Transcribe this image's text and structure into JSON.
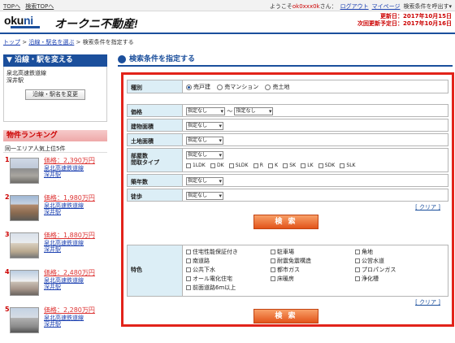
{
  "top_links": [
    "TOPへ",
    "検索TOPへ"
  ],
  "user_bar": {
    "prefix": "ようこそ",
    "user_id": "ok0xxx0k",
    "suffix": "さん：",
    "logout": "ログアウト",
    "mypage": "マイページ",
    "recall": "検索条件を呼出す▾"
  },
  "logo": {
    "okuni_a": "oku",
    "okuni_b": "ni",
    "brand": "オークニ不動産!"
  },
  "updates": {
    "line1": "更新日：2017年10月15日",
    "line2": "次回更新予定日：2017年10月16日"
  },
  "breadcrumb": {
    "top": "トップ",
    "sep1": " > ",
    "choose": "沿線・駅名を選ぶ",
    "sep2": " > ",
    "current": "検索条件を指定する"
  },
  "sidebar": {
    "head": "▼ 沿線・駅を変える",
    "line": "泉北高速鉄道線",
    "station": "深井駅",
    "change_button": "沿線・駅名を変更",
    "ranking_head": "物件ランキング",
    "ranking_sub": "同一エリア人気上位5件",
    "items": [
      {
        "num": "1",
        "price": "価格：2,390万円",
        "line": "泉北高速鉄道線",
        "station": "深井駅"
      },
      {
        "num": "2",
        "price": "価格：1,980万円",
        "line": "泉北高速鉄道線",
        "station": "深井駅"
      },
      {
        "num": "3",
        "price": "価格：1,880万円",
        "line": "泉北高速鉄道線",
        "station": "深井駅"
      },
      {
        "num": "4",
        "price": "価格：2,480万円",
        "line": "泉北高速鉄道線",
        "station": "深井駅"
      },
      {
        "num": "5",
        "price": "価格：2,280万円",
        "line": "泉北高速鉄道線",
        "station": "深井駅"
      }
    ]
  },
  "main": {
    "title": "検索条件を指定する",
    "type_label": "種別",
    "types": [
      "売戸建",
      "売マンション",
      "売土地"
    ],
    "price_label": "価格",
    "price_from": "指定なし",
    "tilde": "〜",
    "price_to": "指定なし",
    "building_area_label": "建物面積",
    "building_area": "指定なし",
    "land_area_label": "土地面積",
    "land_area": "指定なし",
    "rooms_label1": "部屋数",
    "rooms_label2": "間取タイプ",
    "rooms": "指定なし",
    "room_types": [
      "1LDK",
      "DK",
      "SLDK",
      "R",
      "K",
      "SK",
      "LK",
      "SDK",
      "SLK"
    ],
    "age_label": "築年数",
    "age": "指定なし",
    "walk_label": "徒歩",
    "walk": "指定なし",
    "clear": "[ クリア ]",
    "search": "検 索",
    "features_label": "特色",
    "features": [
      "住宅性能保証付き",
      "駐車場",
      "角地",
      "南道路",
      "耐震免震構造",
      "公営水道",
      "公共下水",
      "都市ガス",
      "プロパンガス",
      "オール電化住宅",
      "床暖房",
      "浄化槽",
      "前面道路6m以上"
    ]
  }
}
